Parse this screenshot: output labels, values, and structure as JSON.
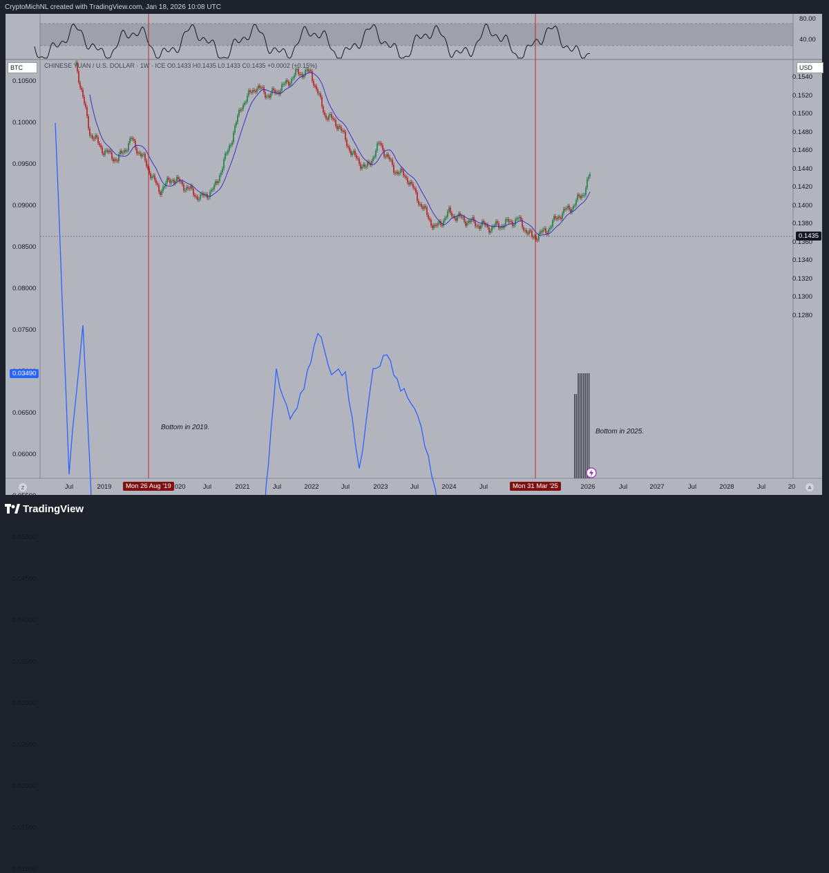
{
  "header": {
    "author_line": "CryptoMichNL created with TradingView.com, Jan 18, 2026 10:08 UTC"
  },
  "left_label": "BTC",
  "right_label": "USD",
  "symbol_line": "CHINESE YUAN / U.S. DOLLAR · 1W · ICE  O0.1433  H0.1435  L0.1433  C0.1435  +0.0002 (+0.15%)",
  "footer": {
    "brand": "TradingView"
  },
  "colors": {
    "panel": "#b2b5be",
    "rsi_band": "#9598a1",
    "up": "#1b7d3a",
    "down": "#b71c1c",
    "blue_line": "#2962ff",
    "ma_line": "#3f2fbd",
    "vline": "#b71c1c",
    "badge": "#801010"
  },
  "icons": {
    "logo": "tradingview-logo-icon",
    "scale_toggle_left": "z-icon",
    "scale_toggle_right": "a-icon",
    "alert": "lightning-icon"
  },
  "chart_data": {
    "type": "line",
    "x_tick_labels": [
      "Jul",
      "2019",
      "2020",
      "Jul",
      "2021",
      "Jul",
      "2022",
      "Jul",
      "2023",
      "Jul",
      "2024",
      "Jul",
      "2025",
      "2026",
      "Jul",
      "2027",
      "Jul",
      "2028",
      "Jul",
      "20"
    ],
    "x_markers": [
      "Mon 26 Aug '19",
      "Mon 31 Mar '25"
    ],
    "left_axis": {
      "label": "BTC",
      "ticks": [
        "0.10500",
        "0.10000",
        "0.09500",
        "0.09000",
        "0.08500",
        "0.08000",
        "0.07500",
        "0.07000",
        "0.06500",
        "0.06000",
        "0.05500",
        "0.05000",
        "0.04500",
        "0.04000",
        "0.03500",
        "0.03000",
        "0.02500",
        "0.02000",
        "0.01500",
        "0.01000"
      ],
      "last_value": "0.03490"
    },
    "right_axis": {
      "label": "USD",
      "ticks": [
        "0.1540",
        "0.1520",
        "0.1500",
        "0.1480",
        "0.1460",
        "0.1440",
        "0.1420",
        "0.1400",
        "0.1380",
        "0.1360",
        "0.1340",
        "0.1320",
        "0.1300",
        "0.1280"
      ],
      "last_value": "0.1435"
    },
    "rsi_axis": {
      "ticks": [
        "80.00",
        "40.00"
      ]
    },
    "series": [
      {
        "x": [
          2018.3,
          2018.5,
          2018.7,
          2018.9,
          2019.1,
          2019.3,
          2019.5,
          2019.65,
          2019.8,
          2020.0,
          2020.2,
          2020.4,
          2020.6,
          2020.8,
          2021.0,
          2021.2,
          2021.35,
          2021.5,
          2021.7,
          2021.9,
          2022.1,
          2022.3,
          2022.5,
          2022.7,
          2022.9,
          2023.1,
          2023.3,
          2023.5,
          2023.7,
          2023.9,
          2024.1,
          2024.3,
          2024.5,
          2024.7,
          2024.9,
          2025.1,
          2025.25,
          2025.4,
          2025.55,
          2025.7,
          2025.85,
          2025.95,
          2026.05
        ],
        "y": [
          0.1,
          0.058,
          0.076,
          0.041,
          0.033,
          0.032,
          0.025,
          0.019,
          0.021,
          0.025,
          0.023,
          0.024,
          0.031,
          0.037,
          0.043,
          0.032,
          0.056,
          0.07,
          0.064,
          0.068,
          0.075,
          0.07,
          0.07,
          0.058,
          0.07,
          0.072,
          0.068,
          0.066,
          0.06,
          0.051,
          0.048,
          0.048,
          0.046,
          0.046,
          0.041,
          0.038,
          0.03,
          0.019,
          0.023,
          0.023,
          0.04,
          0.037,
          0.0349
        ]
      },
      {
        "x": [
          2018.6,
          2018.8,
          2019.0,
          2019.2,
          2019.4,
          2019.6,
          2019.8,
          2020.0,
          2020.2,
          2020.4,
          2020.6,
          2020.8,
          2021.0,
          2021.2,
          2021.4,
          2021.6,
          2021.8,
          2022.0,
          2022.2,
          2022.4,
          2022.6,
          2022.8,
          2023.0,
          2023.2,
          2023.4,
          2023.6,
          2023.8,
          2024.0,
          2024.2,
          2024.4,
          2024.6,
          2024.8,
          2025.0,
          2025.2,
          2025.4,
          2025.6,
          2025.8,
          2025.95,
          2026.05
        ],
        "y": [
          0.1555,
          0.148,
          0.146,
          0.145,
          0.1472,
          0.1448,
          0.1416,
          0.143,
          0.142,
          0.1408,
          0.1418,
          0.146,
          0.151,
          0.153,
          0.152,
          0.153,
          0.1545,
          0.1545,
          0.15,
          0.1488,
          0.1456,
          0.144,
          0.1468,
          0.144,
          0.143,
          0.14,
          0.1375,
          0.1392,
          0.1385,
          0.138,
          0.1376,
          0.138,
          0.1385,
          0.1365,
          0.1372,
          0.139,
          0.14,
          0.1415,
          0.1435
        ]
      }
    ],
    "annotations": [
      "Bottom in 2019.",
      "Bottom in 2025."
    ]
  }
}
